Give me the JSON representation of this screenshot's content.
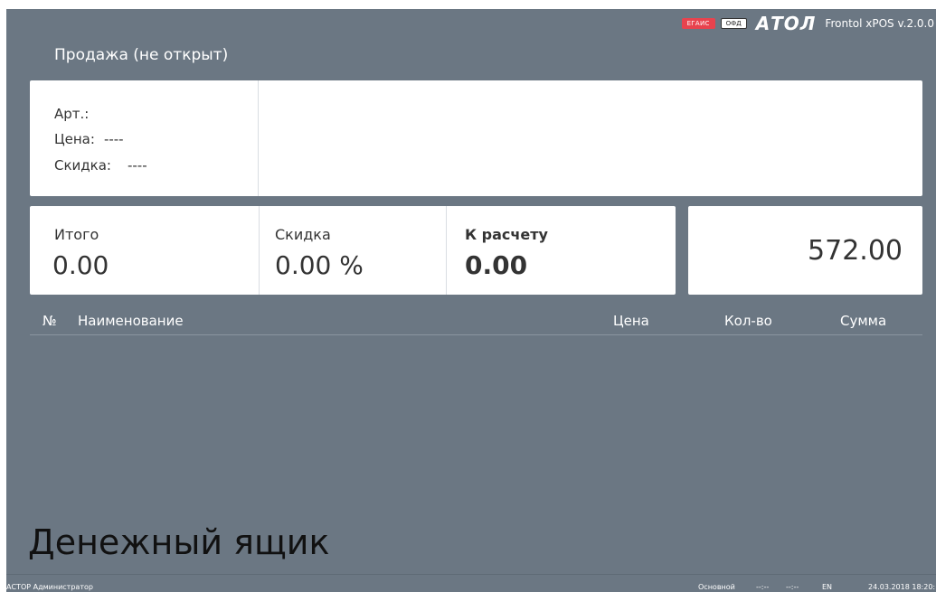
{
  "header": {
    "egais_badge": "ЕГАИС",
    "ofd_badge": "ОФД",
    "logo": "АТОЛ",
    "version": "Frontol xPOS v.2.0.0"
  },
  "status_title": "Продажа (не открыт)",
  "item": {
    "article_label": "Арт.:",
    "article_value": "",
    "price_label": "Цена:",
    "price_value": "----",
    "discount_label": "Скидка:",
    "discount_value": "----"
  },
  "totals": {
    "total_label": "Итого",
    "total_value": "0.00",
    "discount_label": "Скидка",
    "discount_value": "0.00 %",
    "due_label": "К расчету",
    "due_value": "0.00"
  },
  "amount": "572.00",
  "table": {
    "columns": [
      "№",
      "Наименование",
      "Цена",
      "Кол-во",
      "Сумма"
    ],
    "rows": []
  },
  "message": "Денежный ящик",
  "statusbar": {
    "left": "АСТОР  Администратор",
    "mode": "Основной",
    "field1": "--:--",
    "field2": "--:--",
    "lang": "EN",
    "datetime": "24.03.2018 18:20:"
  },
  "colors": {
    "background": "#6b7783",
    "egais": "#e8434e",
    "panel": "#ffffff"
  }
}
